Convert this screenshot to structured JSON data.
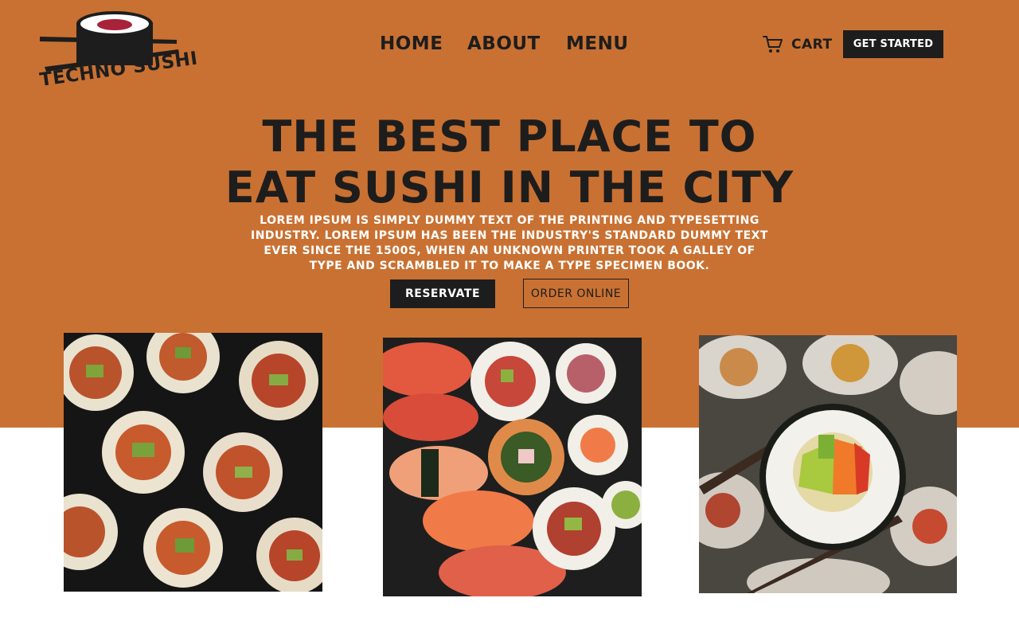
{
  "brand": {
    "name": "TECHNO SUSHI",
    "logo_icon": "sushi-roll-with-chopsticks"
  },
  "nav": {
    "items": [
      {
        "label": "HOME"
      },
      {
        "label": "ABOUT"
      },
      {
        "label": "MENU"
      }
    ],
    "cart_label": "CART",
    "cart_icon": "cart-icon",
    "cta_label": "GET STARTED"
  },
  "hero": {
    "headline_line1": "THE BEST PLACE TO",
    "headline_line2": "EAT SUSHI IN THE CITY",
    "body": "Lorem Ipsum is simply dummy text of the printing and typesetting industry. Lorem Ipsum has been the industry's standard dummy text ever since the 1500s, when an unknown printer took a galley of type and scrambled it to make a type specimen book.",
    "primary_button": "RESERVATE",
    "secondary_button": "ORDER ONLINE"
  },
  "gallery": [
    {
      "subject": "overhead-maki-rolls-photo"
    },
    {
      "subject": "assorted-nigiri-and-maki-photo"
    },
    {
      "subject": "sushi-roll-in-chopsticks-photo"
    }
  ],
  "colors": {
    "hero_orange": "#c97132",
    "dark": "#1d1d1d",
    "white": "#ffffff",
    "tuna_red": "#a8223a"
  }
}
